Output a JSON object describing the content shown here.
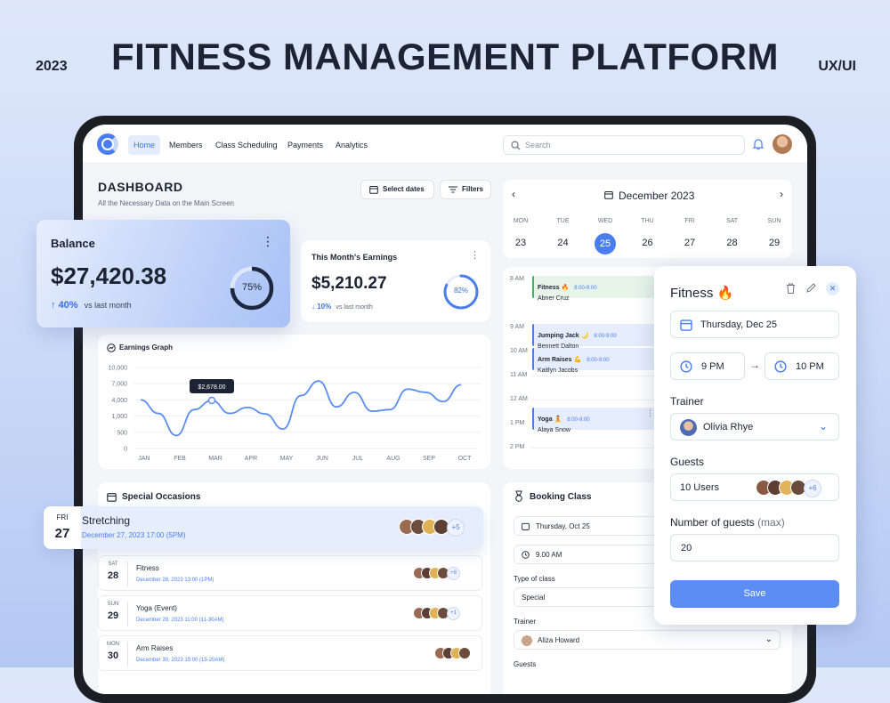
{
  "header": {
    "year": "2023",
    "title": "FITNESS MANAGEMENT PLATFORM",
    "tag": "UX/UI"
  },
  "nav": {
    "items": [
      "Home",
      "Members",
      "Class Scheduling",
      "Payments",
      "Analytics"
    ],
    "active": "Home",
    "search_placeholder": "Search"
  },
  "dashboard": {
    "title": "DASHBOARD",
    "subtitle": "All the Necessary Data on the Main Screen",
    "select_dates": "Select dates",
    "filters": "Filters"
  },
  "balance": {
    "label": "Balance",
    "amount": "$27,420.38",
    "change": "40%",
    "change_note": "vs last month",
    "progress_label": "75%",
    "progress": 0.75
  },
  "earnings": {
    "label": "This Month's Earnings",
    "amount": "$5,210.27",
    "change": "10%",
    "change_note": "vs last month",
    "progress_label": "82%",
    "progress": 0.82
  },
  "chart_data": {
    "type": "line",
    "title": "Earnings Graph",
    "categories": [
      "JAN",
      "FEB",
      "MAR",
      "APR",
      "MAY",
      "JUN",
      "JUL",
      "AUG",
      "SEP",
      "OCT"
    ],
    "ytick_labels": [
      "10,000",
      "7,000",
      "4,000",
      "1,000",
      "500",
      "0"
    ],
    "series": [
      {
        "points": [
          [
            "JAN",
            4000
          ],
          [
            "JAN-FEB",
            1500
          ],
          [
            "FEB",
            400
          ],
          [
            "FEB-MAR",
            2200
          ],
          [
            "MAR",
            3900
          ],
          [
            "MAR-APR",
            1500
          ],
          [
            "APR",
            2600
          ],
          [
            "APR-MAY",
            1400
          ],
          [
            "MAY",
            600
          ],
          [
            "MAY-JUN",
            4800
          ],
          [
            "JUN",
            7500
          ],
          [
            "JUN-JUL",
            2700
          ],
          [
            "JUL",
            5400
          ],
          [
            "JUL-AUG",
            1900
          ],
          [
            "AUG",
            2200
          ],
          [
            "AUG-SEP",
            6000
          ],
          [
            "SEP",
            5400
          ],
          [
            "SEP-OCT",
            3700
          ],
          [
            "OCT",
            6800
          ]
        ]
      }
    ],
    "tooltip": {
      "label": "$2,678.00",
      "at": "MAR"
    },
    "grid": true
  },
  "calendar": {
    "month": "December 2023",
    "weekdays": [
      "MON",
      "TUE",
      "WED",
      "THU",
      "FRI",
      "SAT",
      "SUN"
    ],
    "days": [
      "23",
      "24",
      "25",
      "26",
      "27",
      "28",
      "29"
    ],
    "selected": "25"
  },
  "schedule": {
    "times": [
      "8 AM",
      "9 AM",
      "10 AM",
      "11 AM",
      "12 AM",
      "1 PM",
      "2 PM"
    ],
    "events": [
      {
        "title": "Fitness 🔥",
        "time": "8:00-9:00",
        "person": "Abner Cruz"
      },
      {
        "title": "Jumping Jack 🌙",
        "time": "8:00-9:00",
        "person": "Bennett Dalton"
      },
      {
        "title": "Arm Raises 💪",
        "time": "8:00-9:00",
        "person": "Kaitlyn Jacobs"
      },
      {
        "title": "Yoga 🧘",
        "time": "8:00-9:00",
        "person": "Alaya Snow"
      }
    ]
  },
  "occasions": {
    "title": "Special Occasions",
    "featured": {
      "weekday": "FRI",
      "day": "27",
      "name": "Stretching",
      "date": "December 27, 2023 17:00 (5PM)",
      "more": "+5"
    },
    "items": [
      {
        "weekday": "SAT",
        "day": "28",
        "name": "Fitness",
        "date": "December 28, 2023 13:00 (1PM)",
        "more": "+8"
      },
      {
        "weekday": "SUN",
        "day": "29",
        "name": "Yoga (Event)",
        "date": "December 29, 2023 11:00 (11-30AM)",
        "more": "+1"
      },
      {
        "weekday": "MON",
        "day": "30",
        "name": "Arm Raises",
        "date": "December 30, 2023 15:00 (15-20AM)",
        "more": ""
      }
    ]
  },
  "booking": {
    "title": "Booking Class",
    "date": "Thursday, Oct 25",
    "time": "9.00 AM",
    "type_label": "Type of class",
    "type_value": "Special",
    "trainer_label": "Trainer",
    "trainer_value": "Aliza Howard",
    "guests_label": "Guests"
  },
  "popup": {
    "title": "Fitness 🔥",
    "date": "Thursday, Dec 25",
    "start": "9 PM",
    "end": "10 PM",
    "trainer_label": "Trainer",
    "trainer": "Olivia Rhye",
    "guests_label": "Guests",
    "guests_value": "10 Users",
    "guests_more": "+6",
    "num_label": "Number of guests",
    "num_hint": "(max)",
    "num_value": "20",
    "save": "Save"
  },
  "colors": {
    "accent": "#4a7ef0",
    "dark": "#1c2333",
    "event_green": "#3eb463",
    "event_blue": "#4a7ef0"
  }
}
